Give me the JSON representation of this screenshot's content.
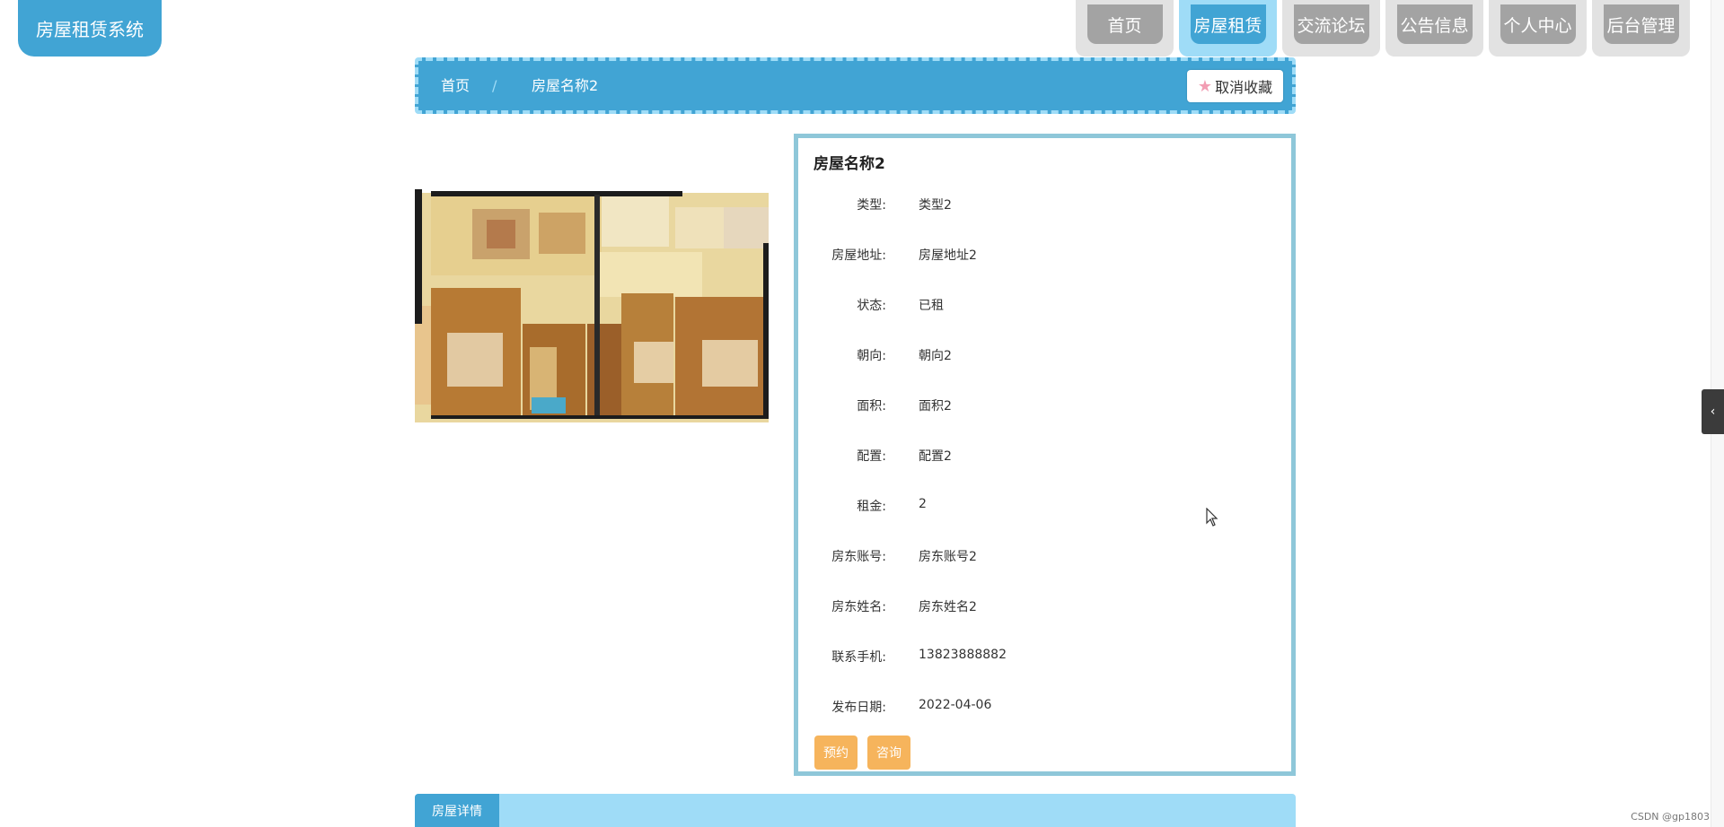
{
  "app": {
    "logo_text": "房屋租赁系统"
  },
  "nav": {
    "items": [
      {
        "label": "首页",
        "active": false
      },
      {
        "label": "房屋租赁",
        "active": true
      },
      {
        "label": "交流论坛",
        "active": false
      },
      {
        "label": "公告信息",
        "active": false
      },
      {
        "label": "个人中心",
        "active": false
      },
      {
        "label": "后台管理",
        "active": false
      }
    ]
  },
  "breadcrumb": {
    "home": "首页",
    "separator": "/",
    "current": "房屋名称2",
    "favorite_label": "取消收藏",
    "favorite_icon": "star-icon"
  },
  "house": {
    "title": "房屋名称2",
    "fields": [
      {
        "label": "类型:",
        "value": "类型2"
      },
      {
        "label": "房屋地址:",
        "value": "房屋地址2"
      },
      {
        "label": "状态:",
        "value": "已租"
      },
      {
        "label": "朝向:",
        "value": "朝向2"
      },
      {
        "label": "面积:",
        "value": "面积2"
      },
      {
        "label": "配置:",
        "value": "配置2"
      },
      {
        "label": "租金:",
        "value": "2"
      },
      {
        "label": "房东账号:",
        "value": "房东账号2"
      },
      {
        "label": "房东姓名:",
        "value": "房东姓名2"
      },
      {
        "label": "联系手机:",
        "value": "13823888882"
      },
      {
        "label": "发布日期:",
        "value": "2022-04-06"
      }
    ],
    "actions": {
      "reserve": "预约",
      "consult": "咨询"
    }
  },
  "tabs": {
    "detail": "房屋详情"
  },
  "watermark": "CSDN @gp1803",
  "colors": {
    "primary": "#41a4d4",
    "primary_light": "#9fdcf7",
    "nav_gray": "#a3a3a3",
    "action_orange": "#f6b45c",
    "panel_border": "#8ec7d9"
  }
}
